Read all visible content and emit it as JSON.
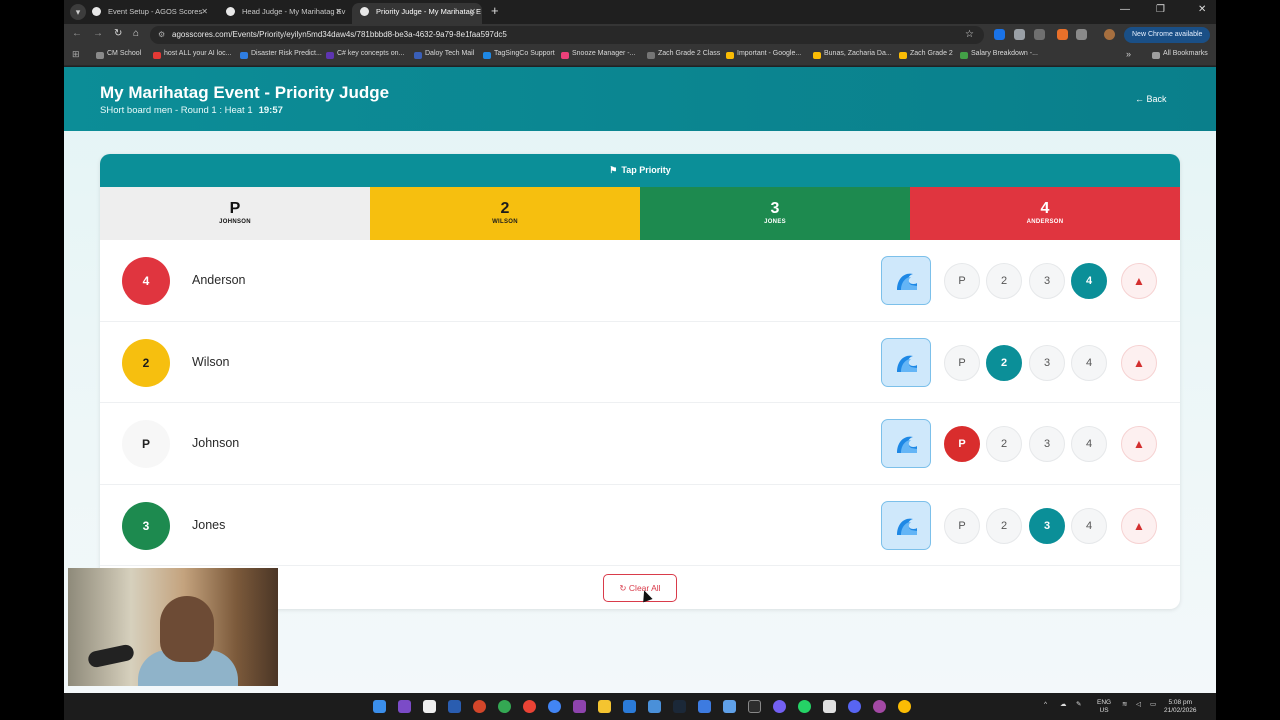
{
  "browser": {
    "tabs": [
      {
        "title": "Event Setup - AGOS Scores",
        "active": false
      },
      {
        "title": "Head Judge - My Marihatag Ev",
        "active": false
      },
      {
        "title": "Priority Judge - My Marihatag E",
        "active": true
      }
    ],
    "url": "agosscores.com/Events/Priority/eyilyn5md34daw4s/781bbbd8-be3a-4632-9a79-8e1faa597dc5",
    "new_chrome_label": "New Chrome available",
    "bookmarks": [
      "CM School",
      "host ALL your AI loc...",
      "Disaster Risk Predict...",
      "C# key concepts on...",
      "Daloy Tech Mail",
      "TagSingCo Support",
      "Snooze Manager -...",
      "Zach Grade 2 Class",
      "Important - Google...",
      "Bunas, Zacharia Da...",
      "Zach Grade 2",
      "Salary Breakdown -..."
    ],
    "all_bookmarks_label": "All Bookmarks"
  },
  "header": {
    "title": "My Marihatag Event - Priority Judge",
    "subtitle": "SHort board men - Round 1 : Heat 1",
    "timer": "19:57",
    "back_label": "Back"
  },
  "card": {
    "title": "Tap Priority",
    "priority_bar": [
      {
        "value": "P",
        "name": "JOHNSON",
        "color": "#eeeeee",
        "text_color": "#111111"
      },
      {
        "value": "2",
        "name": "WILSON",
        "color": "#f6bf0f",
        "text_color": "#1c1c1c"
      },
      {
        "value": "3",
        "name": "JONES",
        "color": "#1d8a4f",
        "text_color": "#ffffff"
      },
      {
        "value": "4",
        "name": "ANDERSON",
        "color": "#e0353f",
        "text_color": "#ffffff"
      }
    ],
    "surfers": [
      {
        "name": "Anderson",
        "badge": "4",
        "badge_color": "#e0353f",
        "badge_text": "#ffffff",
        "selected": "4"
      },
      {
        "name": "Wilson",
        "badge": "2",
        "badge_color": "#f6bf0f",
        "badge_text": "#1c1c1c",
        "selected": "2"
      },
      {
        "name": "Johnson",
        "badge": "P",
        "badge_color": "#f7f7f7",
        "badge_text": "#222222",
        "selected": "P"
      },
      {
        "name": "Jones",
        "badge": "3",
        "badge_color": "#1d8a4f",
        "badge_text": "#ffffff",
        "selected": "3"
      }
    ],
    "priority_options": [
      "P",
      "2",
      "3",
      "4"
    ],
    "clear_label": "Clear All"
  },
  "taskbar": {
    "language": "ENG",
    "region": "US",
    "time": "5:08 pm",
    "date": "21/02/2026"
  }
}
